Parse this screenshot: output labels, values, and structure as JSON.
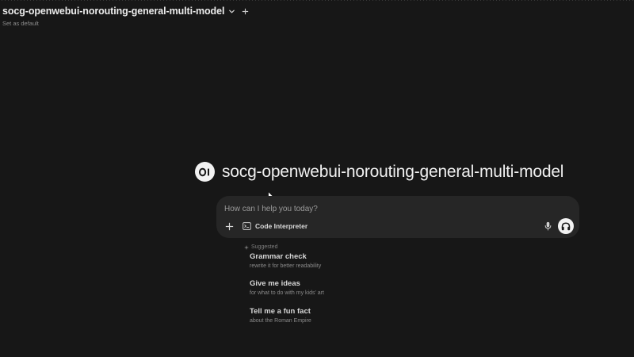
{
  "header": {
    "model_name": "socg-openwebui-norouting-general-multi-model",
    "set_default_label": "Set as default"
  },
  "hero": {
    "logo_text": "OI",
    "title": "socg-openwebui-norouting-general-multi-model"
  },
  "chat": {
    "placeholder": "How can I help you today?",
    "code_interpreter_label": "Code Interpreter"
  },
  "suggestions": {
    "label": "Suggested",
    "items": [
      {
        "title": "Grammar check",
        "subtitle": "rewrite it for better readability"
      },
      {
        "title": "Give me ideas",
        "subtitle": "for what to do with my kids' art"
      },
      {
        "title": "Tell me a fun fact",
        "subtitle": "about the Roman Empire"
      }
    ]
  },
  "icons": {
    "chevron": "chevron-down-icon",
    "new_chat": "plus-icon",
    "attach": "plus-icon",
    "code": "terminal-icon",
    "mic": "microphone-icon",
    "voice": "headphones-icon",
    "suggested": "sparkle-icon"
  },
  "colors": {
    "background": "#171717",
    "chat_box": "#262626",
    "text": "#e5e5e5",
    "muted": "#8a8a8a",
    "accent_light": "#f2f2f2"
  }
}
